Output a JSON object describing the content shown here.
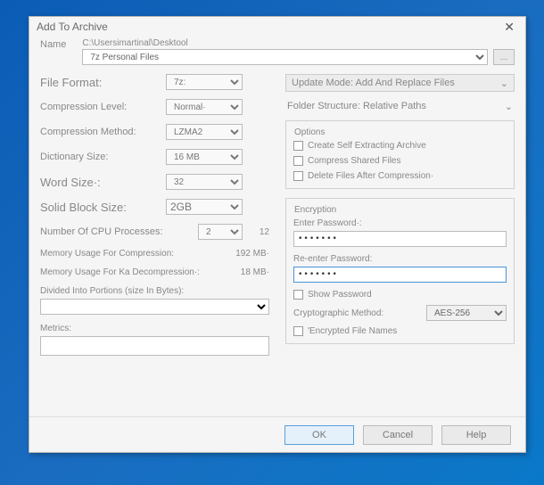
{
  "title": "Add To Archive",
  "name": {
    "label": "Name",
    "path": "C:\\Usersimartinal\\Desktool",
    "archive": "7z Personal Files",
    "browse": "..."
  },
  "left": {
    "file_format": {
      "label": "File Format:",
      "value": "7z:"
    },
    "compression_level": {
      "label": "Compression Level:",
      "value": "Normal·"
    },
    "compression_method": {
      "label": "Compression Method:",
      "value": "LZMA2"
    },
    "dictionary_size": {
      "label": "Dictionary Size:",
      "value": "16 MB"
    },
    "word_size": {
      "label": "Word Size·:",
      "value": "32"
    },
    "solid_block": {
      "label": "Solid Block Size:",
      "value": "2GB"
    },
    "cpu_processes": {
      "label": "Number Of CPU Processes:",
      "value": "2",
      "suffix": "12"
    },
    "mem_compress": {
      "label": "Memory Usage For Compression:",
      "value": "192 MB·"
    },
    "mem_decompress": {
      "label": "Memory Usage For Ka Decompression·:",
      "value": "18 MB·"
    },
    "divided": {
      "label": "Divided Into Portions (size In Bytes):"
    },
    "metrics": {
      "label": "Metrics:"
    }
  },
  "right": {
    "update_mode": "Update Mode: Add And Replace Files",
    "folder_structure": "Folder Structure: Relative Paths",
    "options": {
      "legend": "Options",
      "self_extract": "Create Self Extracting Archive",
      "compress_shared": "Compress Shared Files",
      "delete_after": "Delete Files After Compression·"
    },
    "encryption": {
      "legend": "Encryption",
      "enter_pwd": "Enter Password·:",
      "reenter_pwd": "Re-enter Password:",
      "pwd_value": "•••••••",
      "show_pwd": "Show Password",
      "crypto_method": {
        "label": "Cryptographic Method:",
        "value": "AES-256"
      },
      "encrypt_names": "'Encrypted File Names"
    }
  },
  "buttons": {
    "ok": "OK",
    "cancel": "Cancel",
    "help": "Help"
  }
}
